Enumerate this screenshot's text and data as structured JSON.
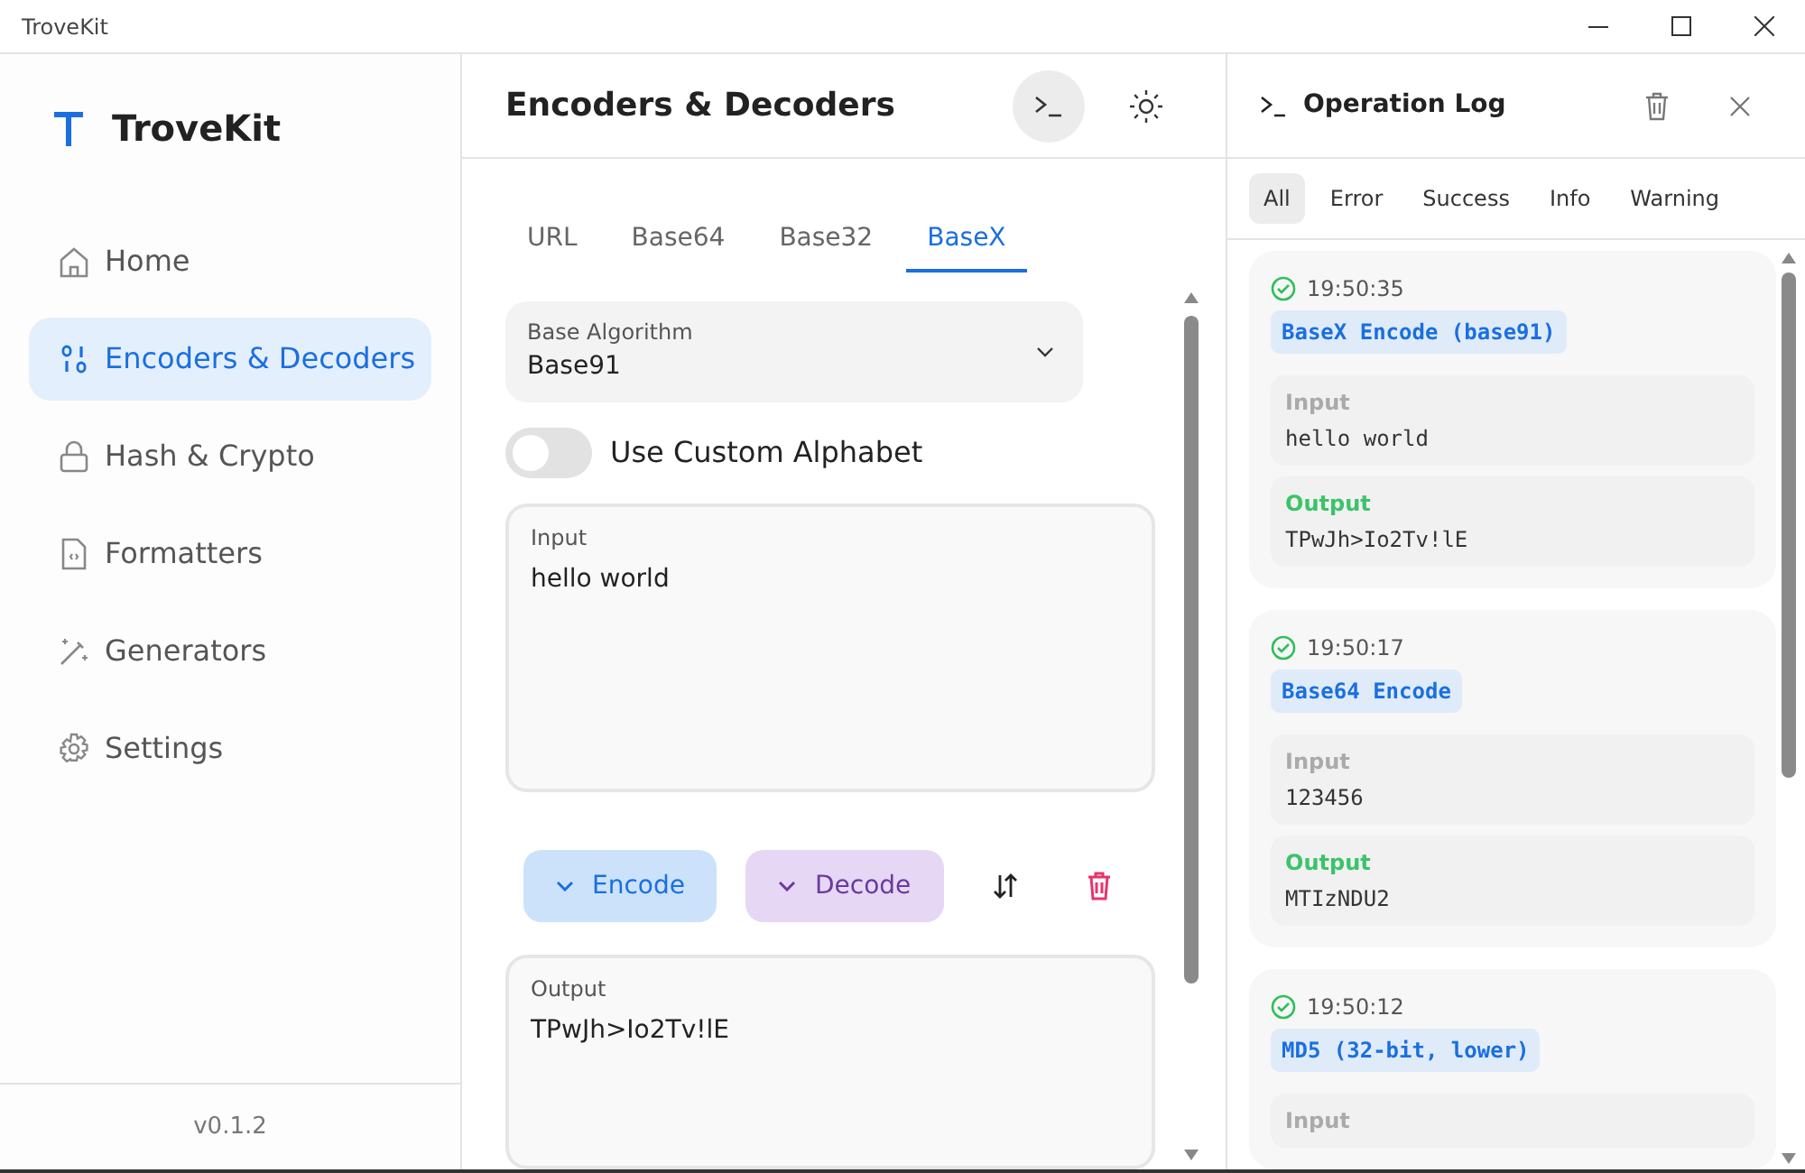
{
  "window": {
    "title": "TroveKit"
  },
  "sidebar": {
    "brand": "TroveKit",
    "items": [
      {
        "label": "Home",
        "selected": false
      },
      {
        "label": "Encoders & Decoders",
        "selected": true
      },
      {
        "label": "Hash & Crypto",
        "selected": false
      },
      {
        "label": "Formatters",
        "selected": false
      },
      {
        "label": "Generators",
        "selected": false
      },
      {
        "label": "Settings",
        "selected": false
      }
    ],
    "version": "v0.1.2"
  },
  "main": {
    "title": "Encoders & Decoders",
    "log_button": {
      "active": true
    },
    "tabs": [
      {
        "label": "URL",
        "selected": false
      },
      {
        "label": "Base64",
        "selected": false
      },
      {
        "label": "Base32",
        "selected": false
      },
      {
        "label": "BaseX",
        "selected": true
      }
    ],
    "algorithm": {
      "label": "Base Algorithm",
      "value": "Base91"
    },
    "custom_alphabet": {
      "label": "Use Custom Alphabet",
      "on": false
    },
    "input": {
      "label": "Input",
      "value": "hello world"
    },
    "buttons": [
      {
        "label": "Encode",
        "kind": "encode"
      },
      {
        "label": "Decode",
        "kind": "decode"
      }
    ],
    "output": {
      "label": "Output",
      "value": "TPwJh>Io2Tv!lE"
    }
  },
  "log": {
    "title": "Operation Log",
    "filters": [
      {
        "label": "All",
        "selected": true
      },
      {
        "label": "Error",
        "selected": false
      },
      {
        "label": "Success",
        "selected": false
      },
      {
        "label": "Info",
        "selected": false
      },
      {
        "label": "Warning",
        "selected": false
      }
    ],
    "entries": [
      {
        "kind": "success",
        "time": "19:50:35",
        "operation": "BaseX Encode (base91)",
        "input_label": "Input",
        "input": "hello world",
        "output_label": "Output",
        "output": "TPwJh>Io2Tv!lE"
      },
      {
        "kind": "success",
        "time": "19:50:17",
        "operation": "Base64 Encode",
        "input_label": "Input",
        "input": "123456",
        "output_label": "Output",
        "output": "MTIzNDU2"
      },
      {
        "kind": "success",
        "time": "19:50:12",
        "operation": "MD5 (32-bit, lower)",
        "input_label": "Input"
      }
    ]
  }
}
